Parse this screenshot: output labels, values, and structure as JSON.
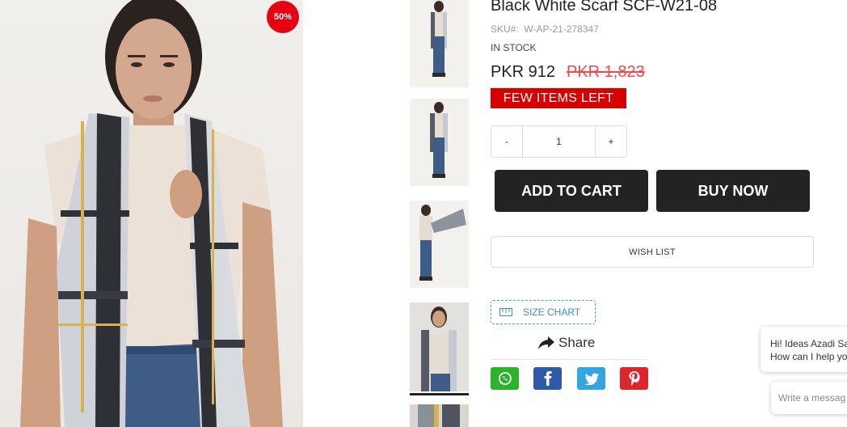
{
  "product": {
    "title": "Black White Scarf SCF-W21-08",
    "sku_label": "SKU#:",
    "sku_value": "W-AP-21-278347",
    "stock_status": "IN STOCK",
    "price": "PKR 912",
    "old_price": "PKR 1,823",
    "discount_badge": "50%",
    "stock_alert": "FEW ITEMS LEFT"
  },
  "quantity": {
    "minus": "-",
    "value": "1",
    "plus": "+"
  },
  "actions": {
    "add_to_cart": "ADD TO CART",
    "buy_now": "BUY NOW",
    "wish_list": "WISH LIST",
    "size_chart": "SIZE CHART",
    "share": "Share"
  },
  "social": [
    {
      "name": "whatsapp",
      "color": "#2cb32c"
    },
    {
      "name": "facebook",
      "color": "#2f5aa8"
    },
    {
      "name": "twitter",
      "color": "#35a5e0"
    },
    {
      "name": "pinterest",
      "color": "#e0242b"
    }
  ],
  "chat": {
    "greeting_line1": "Hi! Ideas Azadi Sa",
    "greeting_line2": "How can I help yo",
    "input_placeholder": "Write a messag"
  },
  "colors": {
    "accent_red": "#d60000",
    "badge_red": "#e60012",
    "button_dark": "#232323",
    "link_blue": "#3d8fbf"
  }
}
